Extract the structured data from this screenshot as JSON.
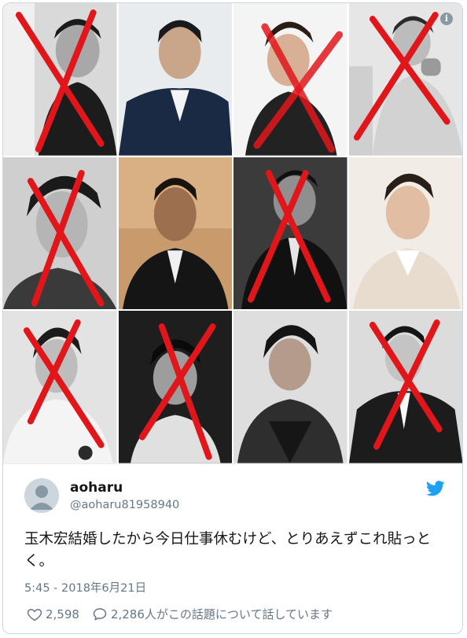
{
  "tweet": {
    "name": "aoharu",
    "handle": "@aoharu81958940",
    "text": "玉木宏結婚したから今日仕事休むけど、とりあえずこれ貼っとく。",
    "timestamp": "5:45 - 2018年6月21日",
    "likes": "2,598",
    "replies_text": "2,286人がこの話題について話しています"
  },
  "icons": {
    "info": "info-icon",
    "brand": "twitter-bird-icon",
    "like": "heart-icon",
    "reply": "comment-icon"
  },
  "colors": {
    "cross": "#e0161b",
    "twitter_blue": "#1da1f2",
    "secondary_text": "#657786"
  },
  "grid": {
    "cells": [
      {
        "crossed": true
      },
      {
        "crossed": false
      },
      {
        "crossed": true
      },
      {
        "crossed": true
      },
      {
        "crossed": true
      },
      {
        "crossed": false
      },
      {
        "crossed": true
      },
      {
        "crossed": false
      },
      {
        "crossed": true
      },
      {
        "crossed": true
      },
      {
        "crossed": false
      },
      {
        "crossed": true
      }
    ]
  }
}
